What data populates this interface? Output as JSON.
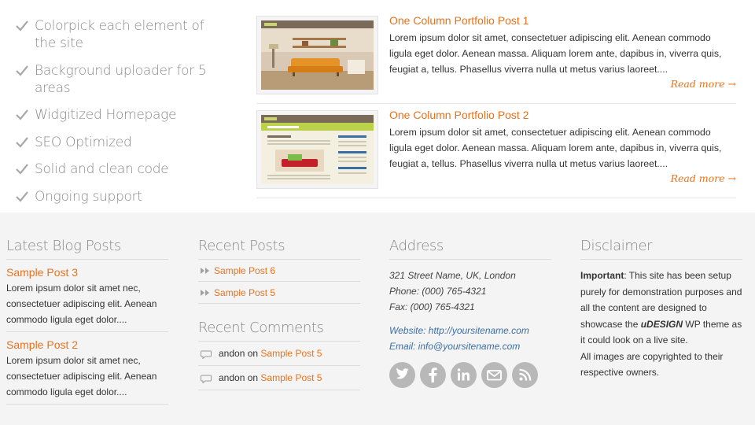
{
  "features": [
    {
      "label": "Colorpick each element of the site"
    },
    {
      "label": "Background uploader for 5 areas"
    },
    {
      "label": "Widgitized Homepage"
    },
    {
      "label": "SEO Optimized"
    },
    {
      "label": "Solid and clean code"
    },
    {
      "label": "Ongoing support"
    }
  ],
  "portfolio": [
    {
      "title": "One Column Portfolio Post 1",
      "text": "Lorem ipsum dolor sit amet, consectetuer adipiscing elit. Aenean commodo ligula eget dolor. Aenean massa. Aliquam lorem ante, dapibus in, viverra quis, feugiat a, tellus. Phasellus viverra nulla ut metus varius laoreet....",
      "more": "Read more →"
    },
    {
      "title": "One Column Portfolio Post 2",
      "text": "Lorem ipsum dolor sit amet, consectetuer adipiscing elit. Aenean commodo ligula eget dolor. Aenean massa. Aliquam lorem ante, dapibus in, viverra quis, feugiat a, tellus. Phasellus viverra nulla ut metus varius laoreet....",
      "more": "Read more →"
    }
  ],
  "footer": {
    "blog": {
      "heading": "Latest Blog Posts",
      "posts": [
        {
          "title": "Sample Post 3",
          "excerpt": "Lorem ipsum dolor sit amet nec, consectetuer adipiscing elit. Aenean commodo ligula eget dolor...."
        },
        {
          "title": "Sample Post 2",
          "excerpt": "Lorem ipsum dolor sit amet nec, consectetuer adipiscing elit. Aenean commodo ligula eget dolor...."
        }
      ]
    },
    "recent_posts": {
      "heading": "Recent Posts",
      "items": [
        "Sample Post 6",
        "Sample Post 5"
      ]
    },
    "recent_comments": {
      "heading": "Recent Comments",
      "items": [
        {
          "author": "andon",
          "on": "on",
          "post": "Sample Post 5"
        },
        {
          "author": "andon",
          "on": "on",
          "post": "Sample Post 5"
        }
      ]
    },
    "address": {
      "heading": "Address",
      "street": "321 Street Name, UK, London",
      "phone": "Phone: (000) 765-4321",
      "fax": "Fax: (000) 765-4321",
      "website": "Website: http://yoursitename.com",
      "email": "Email: info@yoursitename.com",
      "social": [
        "twitter-icon",
        "facebook-icon",
        "linkedin-icon",
        "email-icon",
        "rss-icon"
      ]
    },
    "disclaimer": {
      "heading": "Disclaimer",
      "important": "Important",
      "text1": ": This site has been setup purely for demonstration purposes and all the content are designed to showcase the ",
      "brand": "uDESIGN",
      "text2": " WP theme as it could look on a live site.",
      "text3": "All images are copyrighted to their respective owners."
    }
  },
  "colors": {
    "accent": "#e8721c",
    "link_blue": "#3b6ea5",
    "footer_bg": "#f4f4f4",
    "muted": "#8a8a8a"
  }
}
